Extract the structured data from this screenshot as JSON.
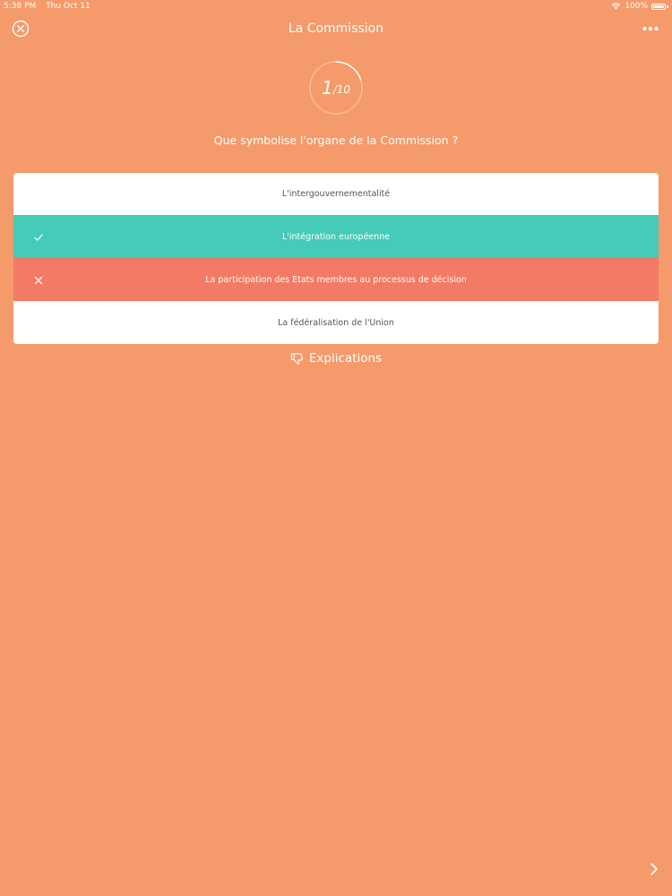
{
  "status_bar": {
    "time": "5:38 PM",
    "date": "Thu Oct 11",
    "battery": "100%"
  },
  "nav": {
    "title": "La Commission",
    "close_icon": "close-circle-icon",
    "more_icon": "more-dots-icon"
  },
  "progress": {
    "current": "1",
    "total": "/10"
  },
  "question": "Que symbolise l'organe de la Commission ?",
  "answers": [
    {
      "label": "L'intergouvernementalité",
      "state": "neutral"
    },
    {
      "label": "L'intégration européenne",
      "state": "correct",
      "icon": "checkmark-icon"
    },
    {
      "label": "La participation des Etats membres au processus de décision",
      "state": "wrong",
      "icon": "cross-icon"
    },
    {
      "label": "La fédéralisation de l'Union",
      "state": "neutral"
    }
  ],
  "explications": {
    "label": "Explications",
    "icon": "thumbs-down-icon"
  },
  "colors": {
    "background": "#F59A6A",
    "correct": "#46CBB9",
    "wrong": "#F37A64"
  }
}
